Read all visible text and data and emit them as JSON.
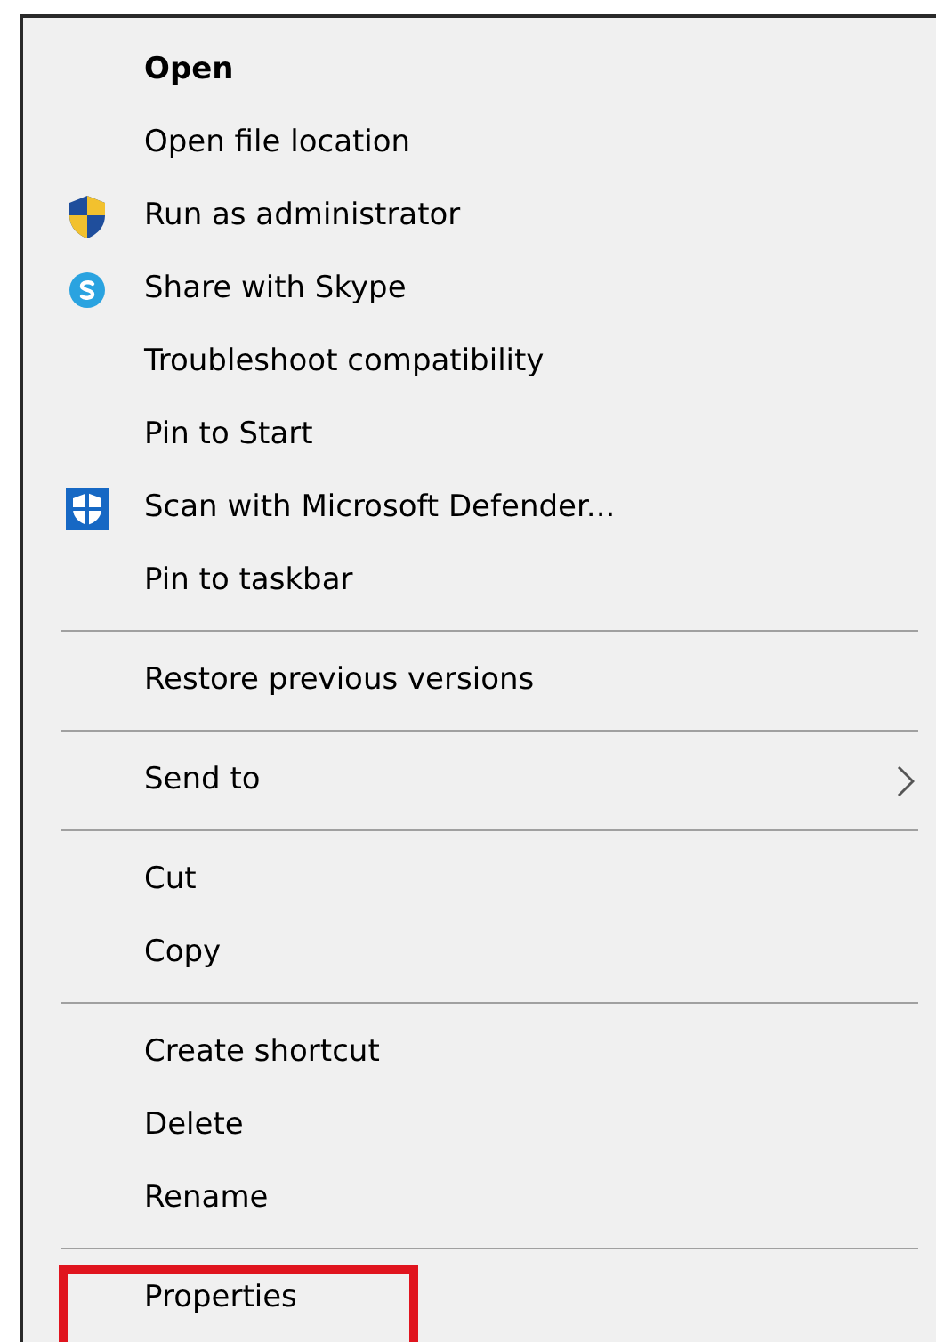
{
  "menu": {
    "groups": [
      [
        {
          "label": "Open",
          "bold": true
        },
        {
          "label": "Open file location"
        },
        {
          "label": "Run as administrator",
          "kind": "shield"
        },
        {
          "label": "Share with Skype",
          "kind": "chat"
        },
        {
          "label": "Troubleshoot compatibility"
        },
        {
          "label": "Pin to Start"
        },
        {
          "label": "Scan with Microsoft Defender...",
          "kind": "defender"
        },
        {
          "label": "Pin to taskbar"
        }
      ],
      [
        {
          "label": "Restore previous versions"
        }
      ],
      [
        {
          "label": "Send to",
          "submenu": true
        }
      ],
      [
        {
          "label": "Cut"
        },
        {
          "label": "Copy"
        }
      ],
      [
        {
          "label": "Create shortcut"
        },
        {
          "label": "Delete"
        },
        {
          "label": "Rename"
        }
      ],
      [
        {
          "label": "Properties",
          "highlighted": true
        }
      ]
    ]
  }
}
